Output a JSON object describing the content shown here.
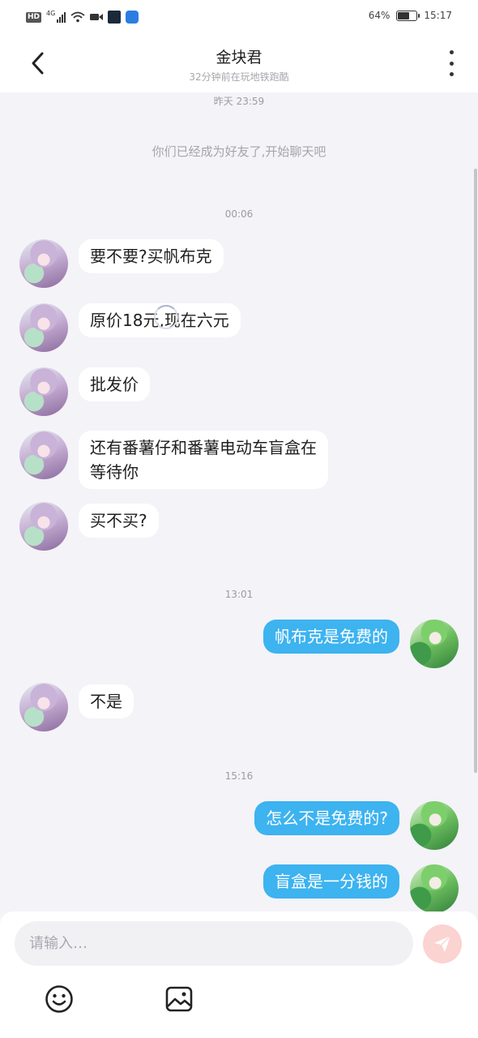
{
  "status_bar": {
    "left_badge": "HD",
    "network": "4G",
    "battery_percent": "64%",
    "battery_level": 0.64,
    "time": "15:17"
  },
  "header": {
    "title": "金块君",
    "subtitle": "32分钟前在玩地铁跑酷"
  },
  "chat": {
    "timestamps": [
      "昨天 23:59",
      "00:06",
      "13:01",
      "15:16"
    ],
    "system_message": "你们已经成为好友了,开始聊天吧",
    "messages": [
      {
        "side": "left",
        "text": "要不要?买帆布克"
      },
      {
        "side": "left",
        "text": "原价18元,现在六元"
      },
      {
        "side": "left",
        "text": "批发价"
      },
      {
        "side": "left",
        "text": "还有番薯仔和番薯电动车盲盒在\n等待你"
      },
      {
        "side": "left",
        "text": "买不买?"
      },
      {
        "side": "right",
        "text": "帆布克是免费的"
      },
      {
        "side": "left",
        "text": "不是"
      },
      {
        "side": "right",
        "text": "怎么不是免费的?"
      },
      {
        "side": "right",
        "text": "盲盒是一分钱的"
      }
    ]
  },
  "composer": {
    "placeholder": "请输入…",
    "icons": [
      "send-icon",
      "emoji-icon",
      "image-icon"
    ]
  },
  "colors": {
    "accent_bubble": "#3db3f0",
    "send_button": "#fbd3d0",
    "background": "#f4f3f8"
  }
}
